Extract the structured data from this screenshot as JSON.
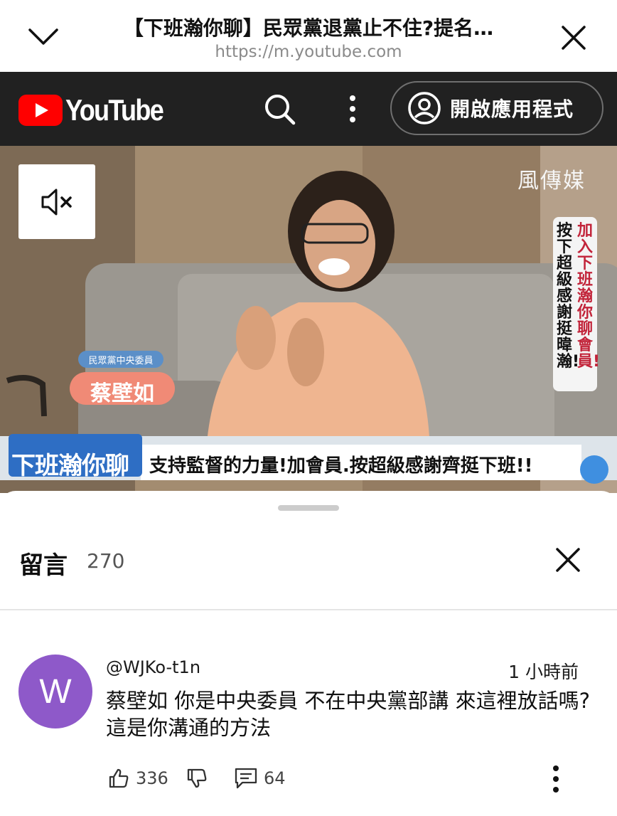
{
  "browser": {
    "page_title": "【下班瀚你聊】民眾黨退黨止不住?提名…",
    "url": "https://m.youtube.com"
  },
  "yt_header": {
    "logo_text": "YouTube",
    "open_app_label": "開啟應用程式"
  },
  "video": {
    "watermark": "風傳媒",
    "name_tag_title": "民眾黨中央委員",
    "name_tag_name": "蔡壁如",
    "show_logo": "下班瀚你聊",
    "ticker": "支持監督的力量!加會員.按超級感謝齊挺下班!!",
    "side_banner_col1": "加入下班瀚你聊會員!",
    "side_banner_col2": "按下超級感謝挺暐瀚!"
  },
  "comments": {
    "title": "留言",
    "count": "270",
    "items": [
      {
        "avatar_letter": "W",
        "avatar_color": "#8e59c9",
        "author": "@WJKo-t1n",
        "time": "1 小時前",
        "text": "蔡壁如 你是中央委員 不在中央黨部講 來這裡放話嗎? 這是你溝通的方法",
        "likes": "336",
        "replies": "64"
      }
    ]
  }
}
